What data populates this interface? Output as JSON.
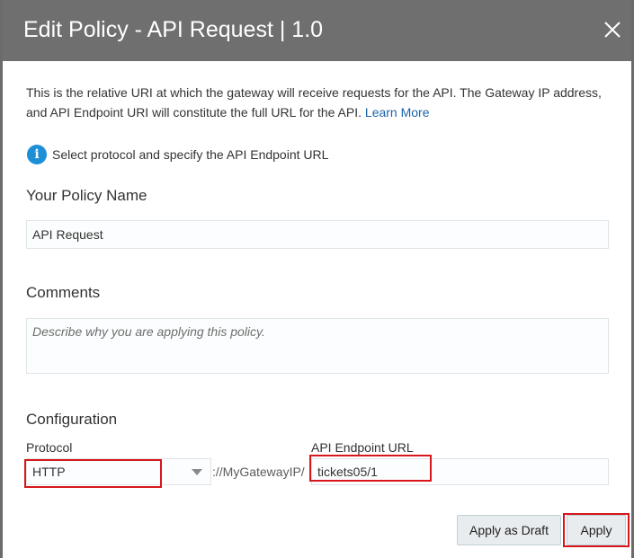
{
  "dialog": {
    "title": "Edit Policy - API Request | 1.0",
    "description": "This is the relative URI at which the gateway will receive requests for the API. The Gateway IP address, and API Endpoint URI will constitute the full URL for the API.",
    "learn_more": "Learn More",
    "info_text": "Select protocol and specify the API Endpoint URL"
  },
  "policy_name": {
    "heading": "Your Policy Name",
    "value": "API Request"
  },
  "comments": {
    "heading": "Comments",
    "placeholder": "Describe why you are applying this policy."
  },
  "configuration": {
    "heading": "Configuration",
    "protocol_label": "Protocol",
    "protocol_value": "HTTP",
    "gateway_text": "://MyGatewayIP/",
    "endpoint_label": "API Endpoint URL",
    "endpoint_value": "tickets05/1"
  },
  "buttons": {
    "apply_as_draft": "Apply as Draft",
    "apply": "Apply"
  },
  "colors": {
    "titlebar": "#6f6f6f",
    "link": "#1a64a9",
    "info": "#1d8fd6",
    "highlight": "#d6171c"
  }
}
